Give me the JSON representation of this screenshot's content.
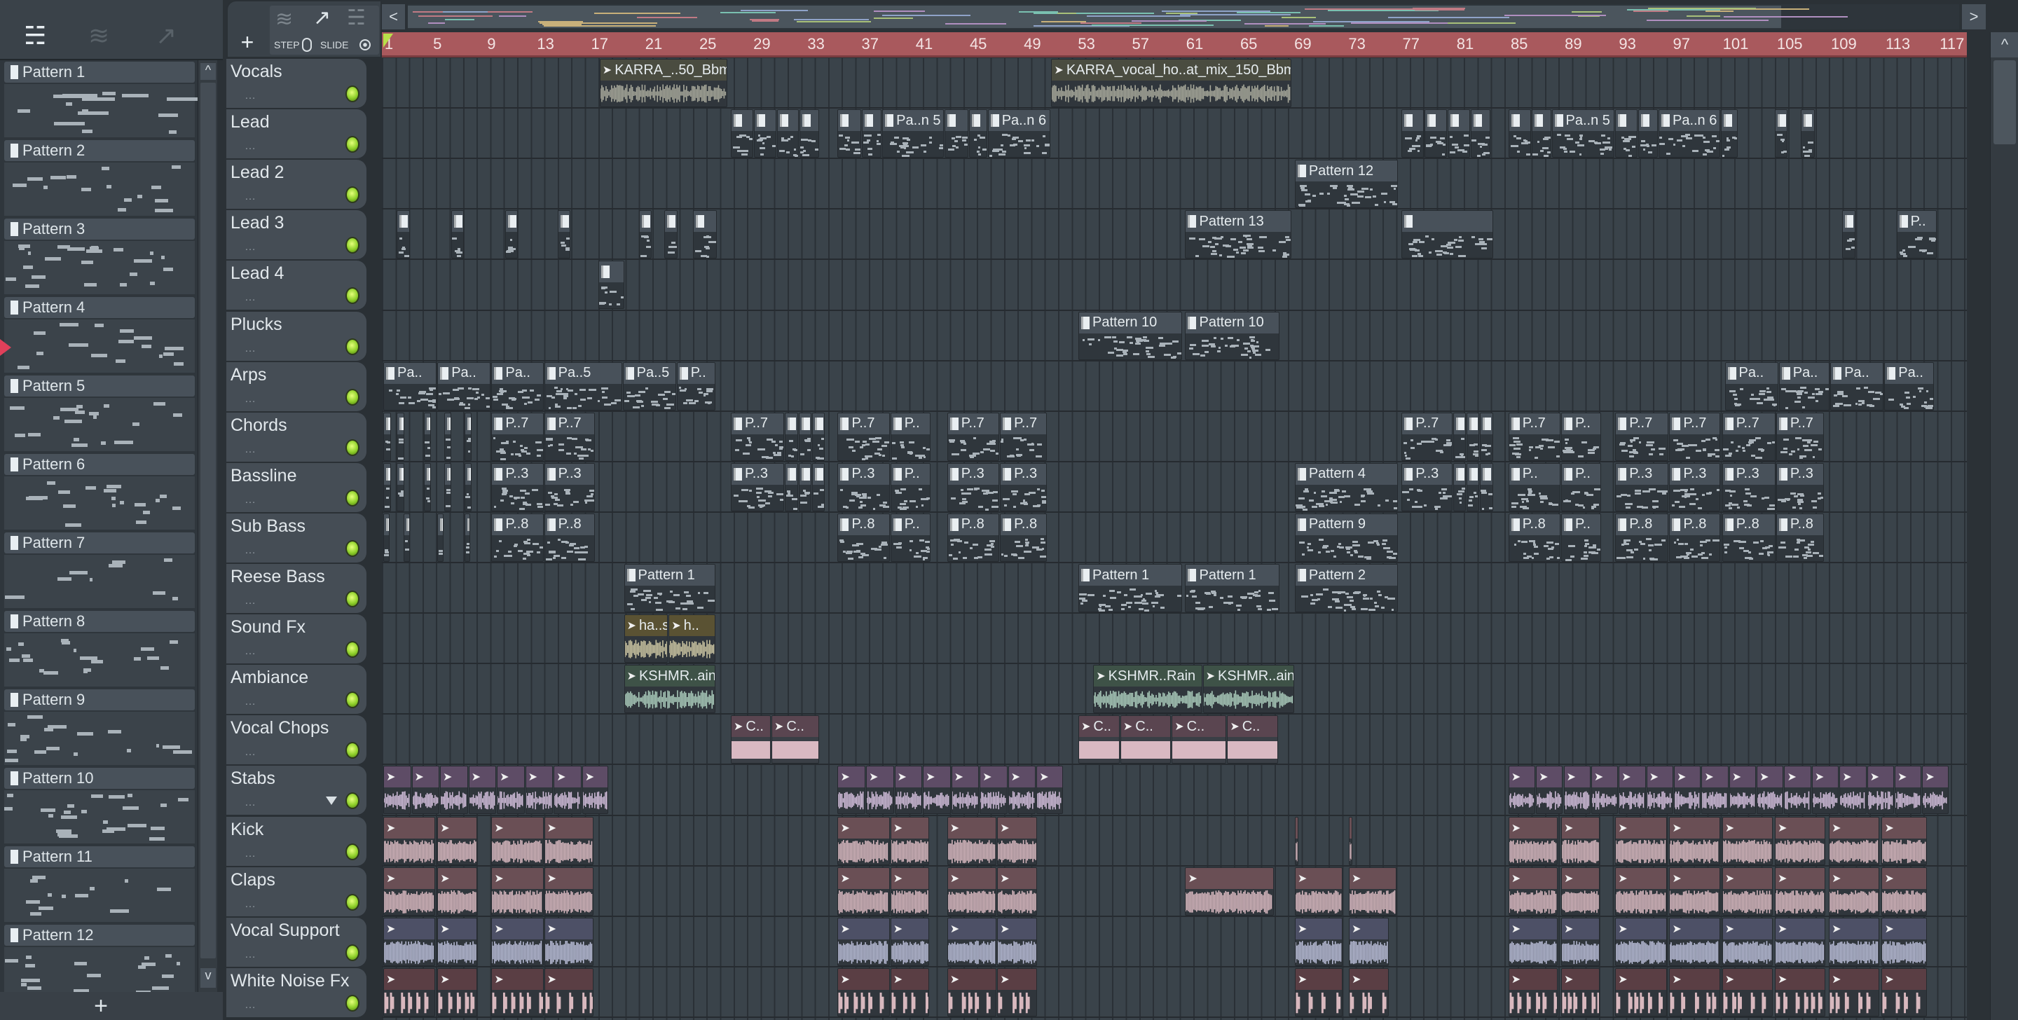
{
  "toolbar": {
    "add_label": "+",
    "step_label": "STEP",
    "slide_label": "SLIDE",
    "prev": "<",
    "next": ">",
    "scroll_up": "^",
    "scroll_down": "v",
    "add_pattern": "+"
  },
  "patterns": [
    "Pattern 1",
    "Pattern 2",
    "Pattern 3",
    "Pattern 4",
    "Pattern 5",
    "Pattern 6",
    "Pattern 7",
    "Pattern 8",
    "Pattern 9",
    "Pattern 10",
    "Pattern 11",
    "Pattern 12"
  ],
  "selected_pattern": "Pattern 4",
  "ruler": {
    "bars": [
      "1",
      "5",
      "9",
      "13",
      "17",
      "21",
      "25",
      "29",
      "33",
      "37",
      "41",
      "45",
      "49",
      "53",
      "57",
      "61",
      "65",
      "69",
      "73",
      "77",
      "81",
      "85",
      "89",
      "93",
      "97",
      "101",
      "105",
      "109",
      "113",
      "117"
    ]
  },
  "colors": {
    "ruler": "#a9595d",
    "led": "#8fd02a",
    "playhead": "#b8e04a"
  },
  "tracks": [
    {
      "name": "Vocals",
      "kind": "audio",
      "head": "#4a4c40",
      "wave": "#a9aa9c",
      "clips": [
        [
          17,
          9.5,
          "KARRA_..50_Bbm"
        ],
        [
          50.4,
          17.8,
          "KARRA_vocal_ho..at_mix_150_Bbm"
        ]
      ]
    },
    {
      "name": "Lead",
      "kind": "pattern",
      "clips": [
        [
          26.7,
          1.7,
          ""
        ],
        [
          28.4,
          1.7,
          ""
        ],
        [
          30.1,
          1.7,
          ""
        ],
        [
          31.8,
          1.5,
          ""
        ],
        [
          34.6,
          1.8,
          ""
        ],
        [
          36.4,
          1.5,
          ""
        ],
        [
          37.9,
          4.6,
          "Pa..n 5"
        ],
        [
          42.5,
          1.8,
          ""
        ],
        [
          44.3,
          1.4,
          ""
        ],
        [
          45.7,
          4.7,
          "Pa..n 6"
        ],
        [
          76.3,
          1.7,
          ""
        ],
        [
          78,
          1.7,
          ""
        ],
        [
          79.7,
          1.7,
          ""
        ],
        [
          81.4,
          1.5,
          ""
        ],
        [
          84.2,
          1.7,
          ""
        ],
        [
          85.9,
          1.5,
          ""
        ],
        [
          87.4,
          4.7,
          "Pa..n 5"
        ],
        [
          92.1,
          1.7,
          ""
        ],
        [
          93.8,
          1.5,
          ""
        ],
        [
          95.3,
          4.6,
          "Pa..n 6"
        ],
        [
          99.9,
          1.3,
          ""
        ],
        [
          103.9,
          1,
          ""
        ],
        [
          105.8,
          1.1,
          ""
        ]
      ]
    },
    {
      "name": "Lead 2",
      "kind": "pattern",
      "clips": [
        [
          68.4,
          7.7,
          "Pattern 12"
        ]
      ]
    },
    {
      "name": "Lead 3",
      "kind": "pattern",
      "clips": [
        [
          2,
          1,
          ""
        ],
        [
          6,
          1,
          ""
        ],
        [
          10,
          1,
          ""
        ],
        [
          13.9,
          1,
          ""
        ],
        [
          19.9,
          1,
          ""
        ],
        [
          21.8,
          1,
          ""
        ],
        [
          23.9,
          1.8,
          ""
        ],
        [
          60.3,
          7.9,
          "Pattern 13"
        ],
        [
          76.3,
          6.8,
          ""
        ],
        [
          108.9,
          1,
          ""
        ],
        [
          112.9,
          3,
          "P.."
        ]
      ]
    },
    {
      "name": "Lead 4",
      "kind": "pattern",
      "clips": [
        [
          16.9,
          2,
          ""
        ]
      ]
    },
    {
      "name": "Plucks",
      "kind": "pattern",
      "clips": [
        [
          52.4,
          7.7,
          "Pattern 10"
        ],
        [
          60.3,
          7,
          "Pattern 10"
        ]
      ]
    },
    {
      "name": "Arps",
      "kind": "pattern",
      "clips": [
        [
          1,
          4,
          "Pa.."
        ],
        [
          5,
          4,
          "Pa.."
        ],
        [
          9,
          3.9,
          "Pa.."
        ],
        [
          12.9,
          5.8,
          "Pa..5"
        ],
        [
          18.7,
          4,
          "Pa..5"
        ],
        [
          22.7,
          2.9,
          "P.."
        ],
        [
          100.2,
          4,
          "Pa.."
        ],
        [
          104.2,
          3.8,
          "Pa.."
        ],
        [
          108,
          4,
          "Pa.."
        ],
        [
          112,
          3.7,
          "Pa.."
        ]
      ]
    },
    {
      "name": "Chords",
      "kind": "pattern",
      "clips": [
        [
          1,
          0.6,
          ""
        ],
        [
          2,
          0.6,
          ""
        ],
        [
          4,
          0.6,
          ""
        ],
        [
          5.5,
          0.6,
          ""
        ],
        [
          7,
          0.6,
          ""
        ],
        [
          9,
          3.9,
          "P..7"
        ],
        [
          12.9,
          3.8,
          "P..7"
        ],
        [
          26.7,
          4,
          "P..7"
        ],
        [
          30.7,
          1,
          ""
        ],
        [
          31.7,
          1,
          ""
        ],
        [
          32.7,
          1,
          ""
        ],
        [
          34.6,
          3.9,
          "P..7"
        ],
        [
          38.5,
          3,
          "P.."
        ],
        [
          42.7,
          3.9,
          "P..7"
        ],
        [
          46.6,
          3.5,
          "P..7"
        ],
        [
          76.3,
          3.8,
          "P..7"
        ],
        [
          80.1,
          1,
          ""
        ],
        [
          81.1,
          1,
          ""
        ],
        [
          82.1,
          1,
          ""
        ],
        [
          84.2,
          3.9,
          "P..7"
        ],
        [
          88.1,
          3,
          "P.."
        ],
        [
          92.1,
          4,
          "P..7"
        ],
        [
          96.1,
          3.8,
          "P..7"
        ],
        [
          100,
          4,
          "P..7"
        ],
        [
          104,
          3.6,
          "P..7"
        ]
      ]
    },
    {
      "name": "Bassline",
      "kind": "pattern",
      "clips": [
        [
          1,
          0.6,
          ""
        ],
        [
          2,
          0.6,
          ""
        ],
        [
          4,
          0.6,
          ""
        ],
        [
          5.5,
          0.6,
          ""
        ],
        [
          7,
          0.6,
          ""
        ],
        [
          9,
          3.9,
          "P..3"
        ],
        [
          12.9,
          3.8,
          "P..3"
        ],
        [
          26.7,
          4,
          "P..3"
        ],
        [
          30.7,
          1,
          ""
        ],
        [
          31.7,
          1,
          ""
        ],
        [
          32.7,
          1,
          ""
        ],
        [
          34.6,
          3.9,
          "P..3"
        ],
        [
          38.5,
          3,
          "P.."
        ],
        [
          42.7,
          3.9,
          "P..3"
        ],
        [
          46.6,
          3.5,
          "P..3"
        ],
        [
          68.4,
          7.7,
          "Pattern 4"
        ],
        [
          76.3,
          3.8,
          "P..3"
        ],
        [
          80.1,
          1,
          ""
        ],
        [
          81.1,
          1,
          ""
        ],
        [
          82.1,
          1,
          ""
        ],
        [
          84.2,
          3.9,
          "P.."
        ],
        [
          88.1,
          3,
          "P.."
        ],
        [
          92.1,
          4,
          "P..3"
        ],
        [
          96.1,
          3.8,
          "P..3"
        ],
        [
          100,
          4,
          "P..3"
        ],
        [
          104,
          3.6,
          "P..3"
        ]
      ]
    },
    {
      "name": "Sub Bass",
      "kind": "pattern",
      "clips": [
        [
          1,
          0.5,
          ""
        ],
        [
          2.5,
          0.5,
          ""
        ],
        [
          5,
          0.5,
          ""
        ],
        [
          7,
          0.5,
          ""
        ],
        [
          9,
          3.9,
          "P..8"
        ],
        [
          12.9,
          3.8,
          "P..8"
        ],
        [
          34.6,
          3.9,
          "P..8"
        ],
        [
          38.5,
          3,
          "P.."
        ],
        [
          42.7,
          3.9,
          "P..8"
        ],
        [
          46.6,
          3.5,
          "P..8"
        ],
        [
          68.4,
          7.7,
          "Pattern 9"
        ],
        [
          84.2,
          3.9,
          "P..8"
        ],
        [
          88.1,
          3,
          "P.."
        ],
        [
          92.1,
          4,
          "P..8"
        ],
        [
          96.1,
          3.8,
          "P..8"
        ],
        [
          100,
          4,
          "P..8"
        ],
        [
          104,
          3.6,
          "P..8"
        ]
      ]
    },
    {
      "name": "Reese Bass",
      "kind": "pattern",
      "clips": [
        [
          18.8,
          6.8,
          "Pattern 1"
        ],
        [
          52.4,
          7.7,
          "Pattern 1"
        ],
        [
          60.3,
          7,
          "Pattern 1"
        ],
        [
          68.4,
          7.7,
          "Pattern 2"
        ]
      ]
    },
    {
      "name": "Sound Fx",
      "kind": "audio",
      "head": "#5a5233",
      "wave": "#cbc5a2",
      "clips": [
        [
          18.8,
          3.3,
          "ha..s"
        ],
        [
          22.1,
          3.5,
          "h.."
        ]
      ]
    },
    {
      "name": "Ambiance",
      "kind": "audio",
      "head": "#3e5247",
      "wave": "#aacbbb",
      "clips": [
        [
          18.8,
          6.8,
          "KSHMR..ain"
        ],
        [
          53.5,
          8.1,
          "KSHMR..Rain"
        ],
        [
          61.6,
          6.8,
          "KSHMR..ain"
        ]
      ]
    },
    {
      "name": "Vocal Chops",
      "kind": "chops",
      "head": "#5a4550",
      "wave": "#d9b9c2",
      "clips": [
        [
          26.7,
          3,
          "C.."
        ],
        [
          29.7,
          3.6,
          "C.."
        ],
        [
          52.4,
          3.1,
          "C.."
        ],
        [
          55.5,
          3.8,
          "C.."
        ],
        [
          59.3,
          4.1,
          "C.."
        ],
        [
          63.4,
          3.8,
          "C.."
        ]
      ]
    },
    {
      "name": "Stabs",
      "kind": "audio",
      "head": "#5e4c66",
      "wave": "#d2bedb",
      "dropdown": true,
      "clips": [
        [
          1,
          2.1,
          ""
        ],
        [
          3.1,
          2.1,
          ""
        ],
        [
          5.2,
          2.1,
          ""
        ],
        [
          7.3,
          2.1,
          ""
        ],
        [
          9.4,
          2.1,
          ""
        ],
        [
          11.5,
          2.1,
          ""
        ],
        [
          13.6,
          2.1,
          ""
        ],
        [
          15.7,
          2,
          ""
        ],
        [
          34.6,
          2.1,
          ""
        ],
        [
          36.7,
          2.1,
          ""
        ],
        [
          38.8,
          2.1,
          ""
        ],
        [
          40.9,
          2.1,
          ""
        ],
        [
          43,
          2.1,
          ""
        ],
        [
          45.1,
          2.1,
          ""
        ],
        [
          47.2,
          2.1,
          ""
        ],
        [
          49.3,
          2,
          ""
        ],
        [
          84.2,
          2.04,
          ""
        ],
        [
          86.24,
          2.04,
          ""
        ],
        [
          88.28,
          2.04,
          ""
        ],
        [
          90.32,
          2.04,
          ""
        ],
        [
          92.36,
          2.04,
          ""
        ],
        [
          94.4,
          2.04,
          ""
        ],
        [
          96.44,
          2.04,
          ""
        ],
        [
          98.48,
          2.04,
          ""
        ],
        [
          100.52,
          2.04,
          ""
        ],
        [
          102.56,
          2.04,
          ""
        ],
        [
          104.6,
          2.04,
          ""
        ],
        [
          106.64,
          2.04,
          ""
        ],
        [
          108.68,
          2.04,
          ""
        ],
        [
          110.72,
          2.04,
          ""
        ],
        [
          112.76,
          2.04,
          ""
        ],
        [
          114.8,
          2,
          ""
        ]
      ]
    },
    {
      "name": "Kick",
      "kind": "audio",
      "head": "#6a4f55",
      "wave": "#dabac1",
      "clips": [
        [
          1,
          3.9,
          ""
        ],
        [
          5,
          3,
          ""
        ],
        [
          9,
          3.9,
          ""
        ],
        [
          12.9,
          3.7,
          ""
        ],
        [
          34.6,
          3.9,
          ""
        ],
        [
          38.5,
          2.9,
          ""
        ],
        [
          42.7,
          3.7,
          ""
        ],
        [
          46.4,
          3,
          ""
        ],
        [
          68.4,
          0.3,
          ""
        ],
        [
          72.4,
          0.3,
          ""
        ],
        [
          84.2,
          3.7,
          ""
        ],
        [
          88.1,
          2.9,
          ""
        ],
        [
          92.1,
          3.9,
          ""
        ],
        [
          96.1,
          3.8,
          ""
        ],
        [
          100,
          3.8,
          ""
        ],
        [
          103.9,
          3.8,
          ""
        ],
        [
          107.9,
          3.8,
          ""
        ],
        [
          111.8,
          3.4,
          ""
        ]
      ]
    },
    {
      "name": "Claps",
      "kind": "audio",
      "head": "#6a4f55",
      "wave": "#dabac1",
      "clips": [
        [
          1,
          3.9,
          ""
        ],
        [
          5,
          3,
          ""
        ],
        [
          9,
          3.9,
          ""
        ],
        [
          12.9,
          3.7,
          ""
        ],
        [
          34.6,
          3.9,
          ""
        ],
        [
          38.5,
          2.9,
          ""
        ],
        [
          42.7,
          3.7,
          ""
        ],
        [
          46.4,
          3,
          ""
        ],
        [
          60.3,
          6.6,
          ""
        ],
        [
          68.4,
          3.6,
          ""
        ],
        [
          72.4,
          3.6,
          ""
        ],
        [
          84.2,
          3.7,
          ""
        ],
        [
          88.1,
          2.9,
          ""
        ],
        [
          92.1,
          3.9,
          ""
        ],
        [
          96.1,
          3.8,
          ""
        ],
        [
          100,
          3.8,
          ""
        ],
        [
          103.9,
          3.8,
          ""
        ],
        [
          107.9,
          3.8,
          ""
        ],
        [
          111.8,
          3.4,
          ""
        ]
      ]
    },
    {
      "name": "Vocal Support",
      "kind": "audio",
      "head": "#4d5066",
      "wave": "#b9bdd7",
      "clips": [
        [
          1,
          3.9,
          ""
        ],
        [
          5,
          3,
          ""
        ],
        [
          9,
          3.9,
          ""
        ],
        [
          12.9,
          3.7,
          ""
        ],
        [
          34.6,
          3.9,
          ""
        ],
        [
          38.5,
          2.9,
          ""
        ],
        [
          42.7,
          3.7,
          ""
        ],
        [
          46.4,
          3,
          ""
        ],
        [
          68.4,
          3.6,
          ""
        ],
        [
          72.4,
          3,
          ""
        ],
        [
          84.2,
          3.7,
          ""
        ],
        [
          88.1,
          2.9,
          ""
        ],
        [
          92.1,
          3.9,
          ""
        ],
        [
          96.1,
          3.8,
          ""
        ],
        [
          100,
          3.8,
          ""
        ],
        [
          103.9,
          3.8,
          ""
        ],
        [
          107.9,
          3.8,
          ""
        ],
        [
          111.8,
          3.4,
          ""
        ]
      ]
    },
    {
      "name": "White Noise Fx",
      "kind": "sparse",
      "head": "#5a3e44",
      "wave": "#d8b8be",
      "clips": [
        [
          1,
          3.9,
          ""
        ],
        [
          5,
          3,
          ""
        ],
        [
          9,
          3.9,
          ""
        ],
        [
          12.9,
          3.7,
          ""
        ],
        [
          34.6,
          3.9,
          ""
        ],
        [
          38.5,
          2.9,
          ""
        ],
        [
          42.7,
          3.7,
          ""
        ],
        [
          46.4,
          3,
          ""
        ],
        [
          68.4,
          3.6,
          ""
        ],
        [
          72.4,
          3,
          ""
        ],
        [
          84.2,
          3.7,
          ""
        ],
        [
          88.1,
          2.9,
          ""
        ],
        [
          92.1,
          3.9,
          ""
        ],
        [
          96.1,
          3.8,
          ""
        ],
        [
          100,
          3.8,
          ""
        ],
        [
          103.9,
          3.8,
          ""
        ],
        [
          107.9,
          3.8,
          ""
        ],
        [
          111.8,
          3.4,
          ""
        ]
      ]
    }
  ]
}
